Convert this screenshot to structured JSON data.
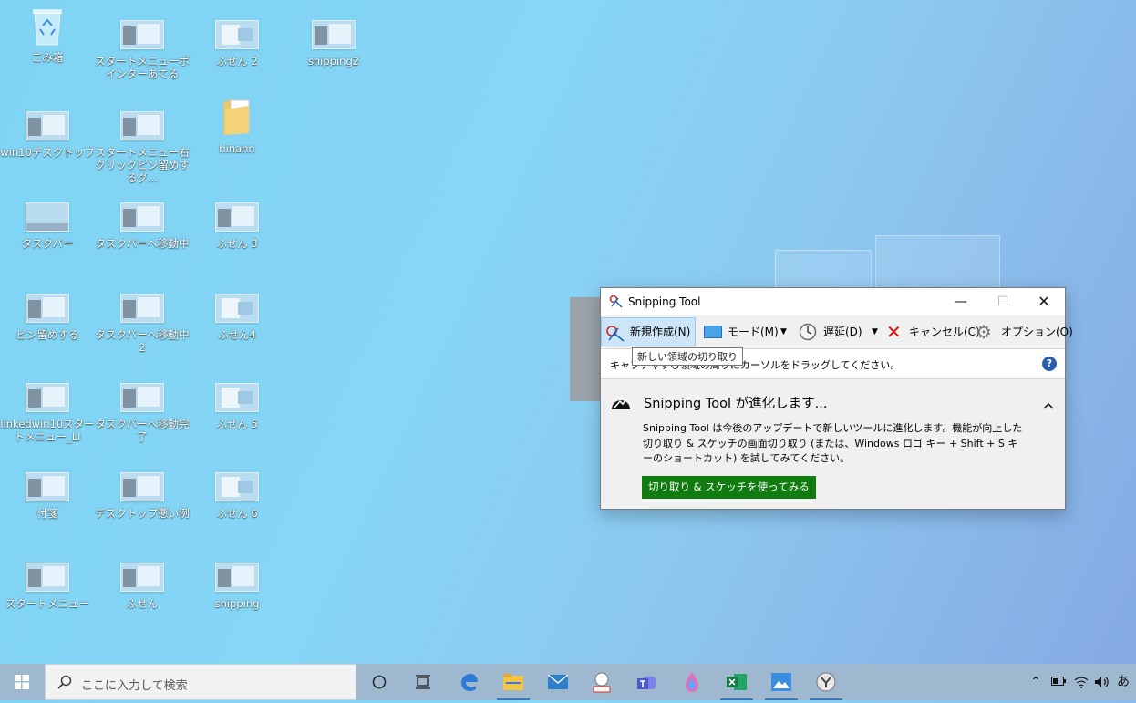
{
  "desktop": {
    "icons": [
      {
        "label": "ごみ箱",
        "kind": "recycle-bin"
      },
      {
        "label": "スタートメニューポインターあてる",
        "kind": "screenshot"
      },
      {
        "label": "ふせん 2",
        "kind": "note"
      },
      {
        "label": "snipping2",
        "kind": "screenshot"
      },
      {
        "label": "win10デスクトップ",
        "kind": "screenshot"
      },
      {
        "label": "スタートメニュー右クリックピン留めするグ...",
        "kind": "screenshot"
      },
      {
        "label": "hinann",
        "kind": "folder"
      },
      {
        "label": "タスクバー",
        "kind": "screenshot"
      },
      {
        "label": "タスクバーへ移動中",
        "kind": "screenshot"
      },
      {
        "label": "ふせん 3",
        "kind": "screenshot"
      },
      {
        "label": "ピン留めする",
        "kind": "screenshot"
      },
      {
        "label": "タスクバーへ移動中 2",
        "kind": "screenshot"
      },
      {
        "label": "ふせん4",
        "kind": "note"
      },
      {
        "label": "linkedwin10スタートメニュー_LI",
        "kind": "screenshot"
      },
      {
        "label": "タスクバーへ移動完了",
        "kind": "screenshot"
      },
      {
        "label": "ふせん 5",
        "kind": "note"
      },
      {
        "label": "付箋",
        "kind": "screenshot"
      },
      {
        "label": "デスクトップ悪い例",
        "kind": "screenshot"
      },
      {
        "label": "ふせん 6",
        "kind": "note"
      },
      {
        "label": "スタートメニュー",
        "kind": "screenshot"
      },
      {
        "label": "ふせん",
        "kind": "screenshot"
      },
      {
        "label": "snipping",
        "kind": "screenshot"
      }
    ]
  },
  "snipping": {
    "title": "Snipping Tool",
    "toolbar": {
      "new": "新規作成(N)",
      "mode": "モード(M)",
      "delay": "遅延(D)",
      "cancel": "キャンセル(C)",
      "options": "オプション(O)"
    },
    "tooltip": "新しい領域の切り取り",
    "instruction": "キャプチャする領域の周りにカーソルをドラッグしてください。",
    "evolve_title": "Snipping Tool が進化します...",
    "evolve_body": "Snipping Tool は今後のアップデートで新しいツールに進化します。機能が向上した切り取り & スケッチの画面切り取り (または、Windows ロゴ キー + Shift + S キーのショートカット) を試してみてください。",
    "evolve_button": "切り取り & スケッチを使ってみる",
    "help": "?"
  },
  "taskbar": {
    "search_placeholder": "ここに入力して検索",
    "apps": [
      "cortana-icon",
      "task-view-icon",
      "edge-icon",
      "file-explorer-icon",
      "mail-icon",
      "app-icon",
      "teams-icon",
      "paint-icon",
      "excel-icon",
      "photos-icon",
      "snipping-icon"
    ],
    "ime": "あ"
  },
  "colors": {
    "accent": "#3d78b8",
    "button_green": "#107c10"
  }
}
